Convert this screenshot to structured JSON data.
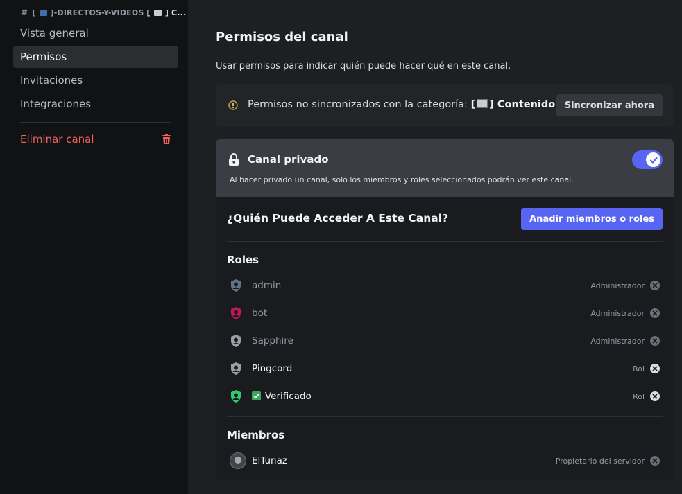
{
  "sidebar": {
    "channel_header": "[",
    "channel_header_mid": "]-DIRECTOS-Y-VIDEOS",
    "channel_header_tail": "[",
    "channel_header_end": "] C...",
    "items": [
      {
        "label": "Vista general"
      },
      {
        "label": "Permisos"
      },
      {
        "label": "Invitaciones"
      },
      {
        "label": "Integraciones"
      }
    ],
    "delete_label": "Eliminar canal"
  },
  "main": {
    "title": "Permisos del canal",
    "subtitle": "Usar permisos para indicar quién puede hacer qué en este canal.",
    "sync": {
      "text": "Permisos no sincronizados con la categoría: ",
      "category_open": "[",
      "category_close": "] Contenido",
      "button": "Sincronizar ahora"
    },
    "private": {
      "title": "Canal privado",
      "description": "Al hacer privado un canal, solo los miembros y roles seleccionados podrán ver este canal.",
      "enabled": true
    },
    "access_title": "¿Quién Puede Acceder A Este Canal?",
    "add_button": "Añadir miembros o roles",
    "roles_heading": "Roles",
    "roles": [
      {
        "name": "admin",
        "tag": "Administrador",
        "color": "#7289a0"
      },
      {
        "name": "bot",
        "tag": "Administrador",
        "color": "#c2185b"
      },
      {
        "name": "Sapphire",
        "tag": "Administrador",
        "color": "#9aa0a8"
      },
      {
        "name": "Pingcord",
        "tag": "Rol",
        "color": "#9aa0a8"
      },
      {
        "name": "Verificado",
        "tag": "Rol",
        "color": "#2ecc71"
      }
    ],
    "members_heading": "Miembros",
    "members": [
      {
        "name": "ElTunaz",
        "tag": "Propietario del servidor"
      }
    ]
  }
}
